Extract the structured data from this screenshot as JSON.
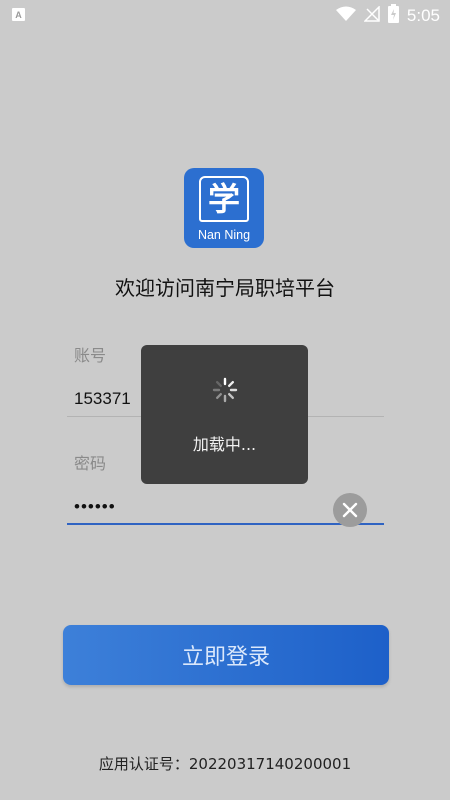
{
  "status_bar": {
    "left_icon_letter": "A",
    "icons": [
      "wifi-icon",
      "signal-off-icon",
      "battery-charging-icon"
    ],
    "time": "5:05"
  },
  "logo": {
    "glyph": "学",
    "text": "Nan Ning",
    "color": "#2c6fd0"
  },
  "title": "欢迎访问南宁局职培平台",
  "account": {
    "label": "账号",
    "value": "153371"
  },
  "password": {
    "label": "密码",
    "value": "••••••"
  },
  "login_button": {
    "label": "立即登录",
    "color": "#2a6fd4"
  },
  "certificate": "应用认证号：20220317140200001",
  "loading": {
    "text": "加载中..."
  }
}
